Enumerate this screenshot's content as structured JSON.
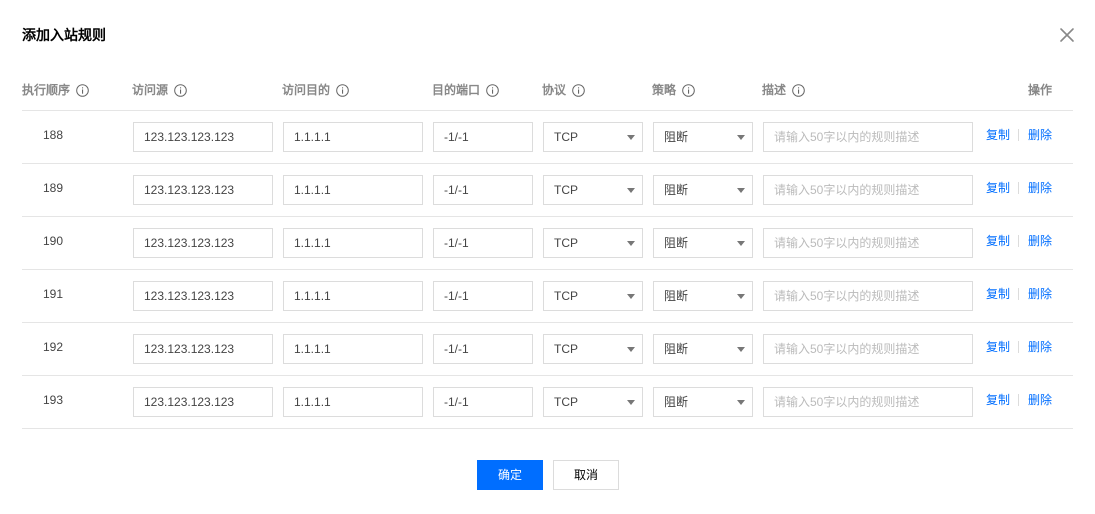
{
  "dialog": {
    "title": "添加入站规则"
  },
  "header": {
    "seq": "执行顺序",
    "source": "访问源",
    "destination": "访问目的",
    "port": "目的端口",
    "protocol": "协议",
    "policy": "策略",
    "description": "描述",
    "actions": "操作"
  },
  "icons": {
    "info": "info-icon",
    "close": "close-icon",
    "dropdown": "chevron-down-icon"
  },
  "rows": [
    {
      "seq": "188",
      "source": "123.123.123.123",
      "destination": "1.1.1.1",
      "port": "-1/-1",
      "protocol": "TCP",
      "policy": "阻断",
      "description_placeholder": "请输入50字以内的规则描述",
      "copy": "复制",
      "delete": "删除"
    },
    {
      "seq": "189",
      "source": "123.123.123.123",
      "destination": "1.1.1.1",
      "port": "-1/-1",
      "protocol": "TCP",
      "policy": "阻断",
      "description_placeholder": "请输入50字以内的规则描述",
      "copy": "复制",
      "delete": "删除"
    },
    {
      "seq": "190",
      "source": "123.123.123.123",
      "destination": "1.1.1.1",
      "port": "-1/-1",
      "protocol": "TCP",
      "policy": "阻断",
      "description_placeholder": "请输入50字以内的规则描述",
      "copy": "复制",
      "delete": "删除"
    },
    {
      "seq": "191",
      "source": "123.123.123.123",
      "destination": "1.1.1.1",
      "port": "-1/-1",
      "protocol": "TCP",
      "policy": "阻断",
      "description_placeholder": "请输入50字以内的规则描述",
      "copy": "复制",
      "delete": "删除"
    },
    {
      "seq": "192",
      "source": "123.123.123.123",
      "destination": "1.1.1.1",
      "port": "-1/-1",
      "protocol": "TCP",
      "policy": "阻断",
      "description_placeholder": "请输入50字以内的规则描述",
      "copy": "复制",
      "delete": "删除"
    },
    {
      "seq": "193",
      "source": "123.123.123.123",
      "destination": "1.1.1.1",
      "port": "-1/-1",
      "protocol": "TCP",
      "policy": "阻断",
      "description_placeholder": "请输入50字以内的规则描述",
      "copy": "复制",
      "delete": "删除"
    }
  ],
  "footer": {
    "confirm": "确定",
    "cancel": "取消"
  },
  "colors": {
    "primary": "#006eff",
    "border": "#dcdcdc",
    "divider": "#e5e5e5"
  }
}
